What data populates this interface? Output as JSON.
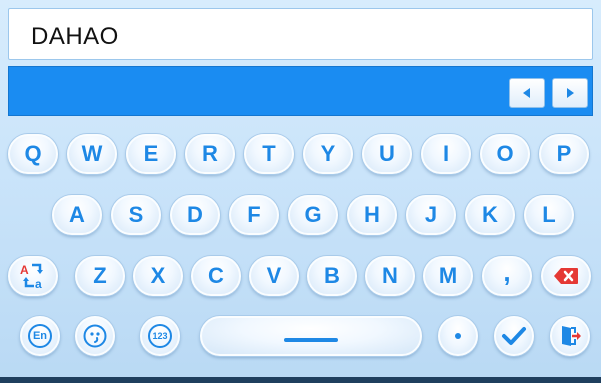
{
  "input": {
    "value": "DAHAO"
  },
  "keys": {
    "row1": [
      "Q",
      "W",
      "E",
      "R",
      "T",
      "Y",
      "U",
      "I",
      "O",
      "P"
    ],
    "row2": [
      "A",
      "S",
      "D",
      "F",
      "G",
      "H",
      "J",
      "K",
      "L"
    ],
    "row3": [
      "Z",
      "X",
      "C",
      "V",
      "B",
      "N",
      "M"
    ],
    "comma": ",",
    "lang": "En",
    "num": "123"
  },
  "icons": {
    "case": "case-toggle-icon",
    "backspace": "backspace-icon",
    "emoji": "emoji-icon",
    "space": "space-icon",
    "confirm": "checkmark-icon",
    "exit": "exit-door-icon",
    "left": "left-arrow-icon",
    "right": "right-arrow-icon"
  },
  "colors": {
    "accent": "#1e88e5",
    "candidate_bar": "#1a8cf2",
    "backspace": "#e53935",
    "exit": "#e53935"
  }
}
